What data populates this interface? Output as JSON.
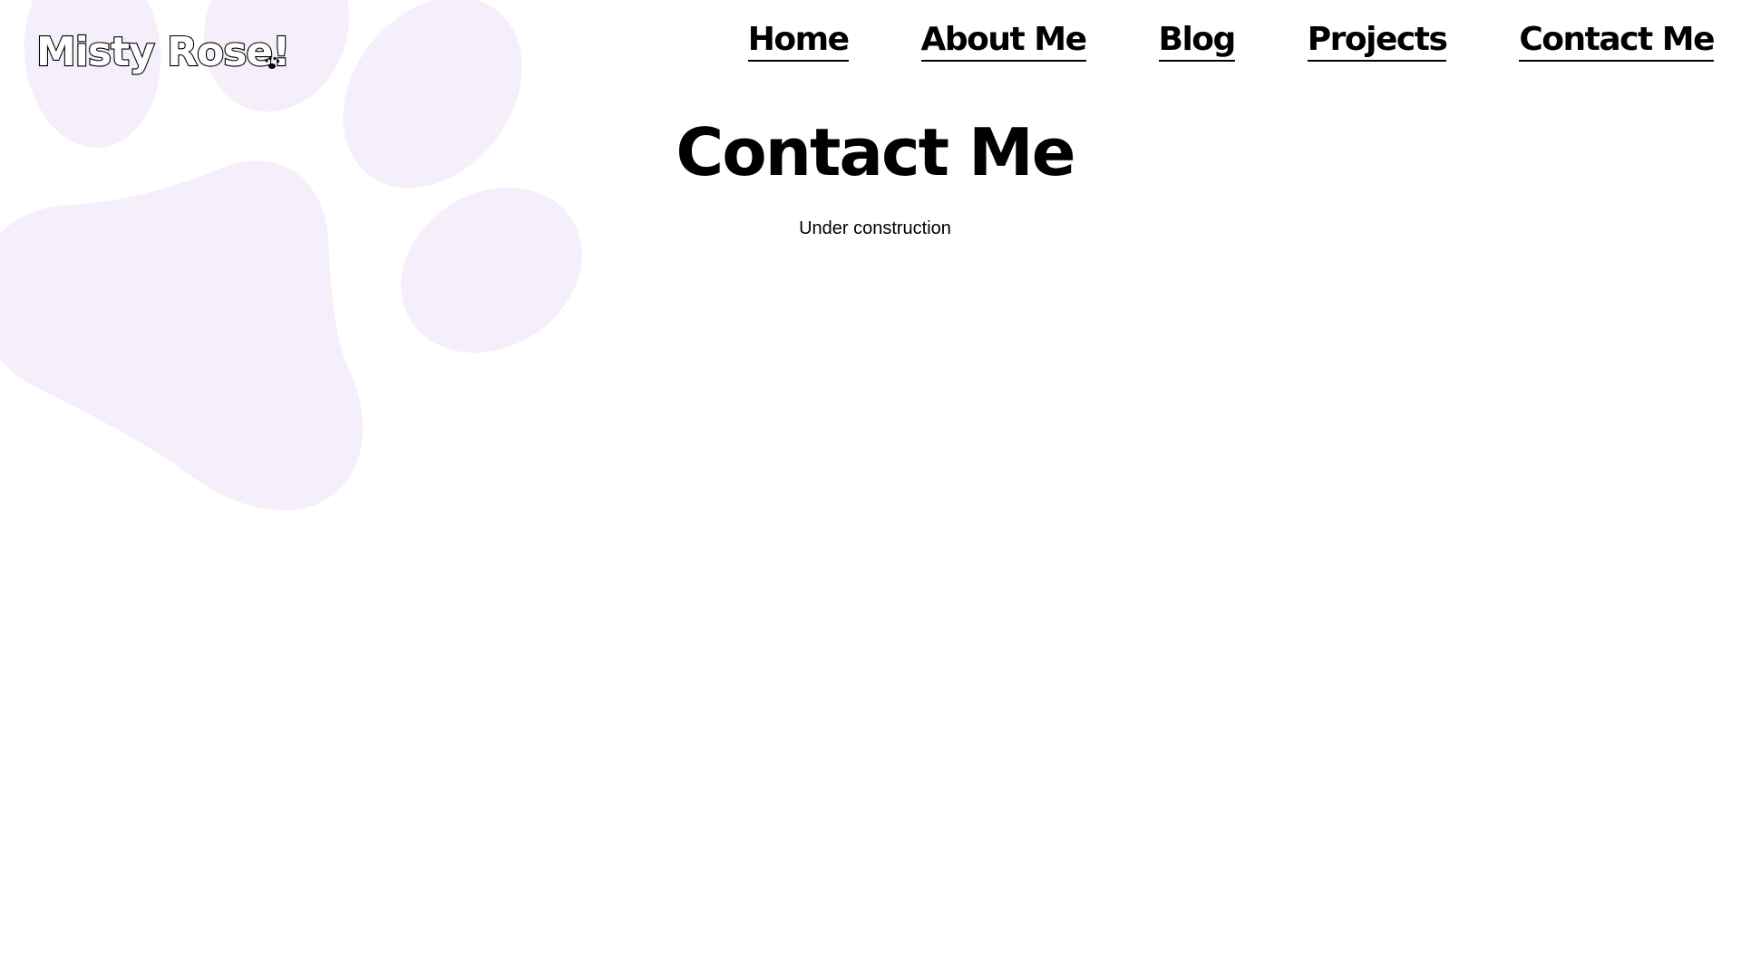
{
  "site": {
    "logo_text": "Misty Rose!"
  },
  "nav": {
    "items": [
      {
        "label": "Home"
      },
      {
        "label": "About Me"
      },
      {
        "label": "Blog"
      },
      {
        "label": "Projects"
      },
      {
        "label": "Contact Me"
      }
    ]
  },
  "main": {
    "title": "Contact Me",
    "body": "Under construction"
  },
  "colors": {
    "background": "#ffffff",
    "paw_print": "#f5eefb",
    "text": "#000000"
  },
  "icons": {
    "background_decoration": "paw-print-icon"
  }
}
